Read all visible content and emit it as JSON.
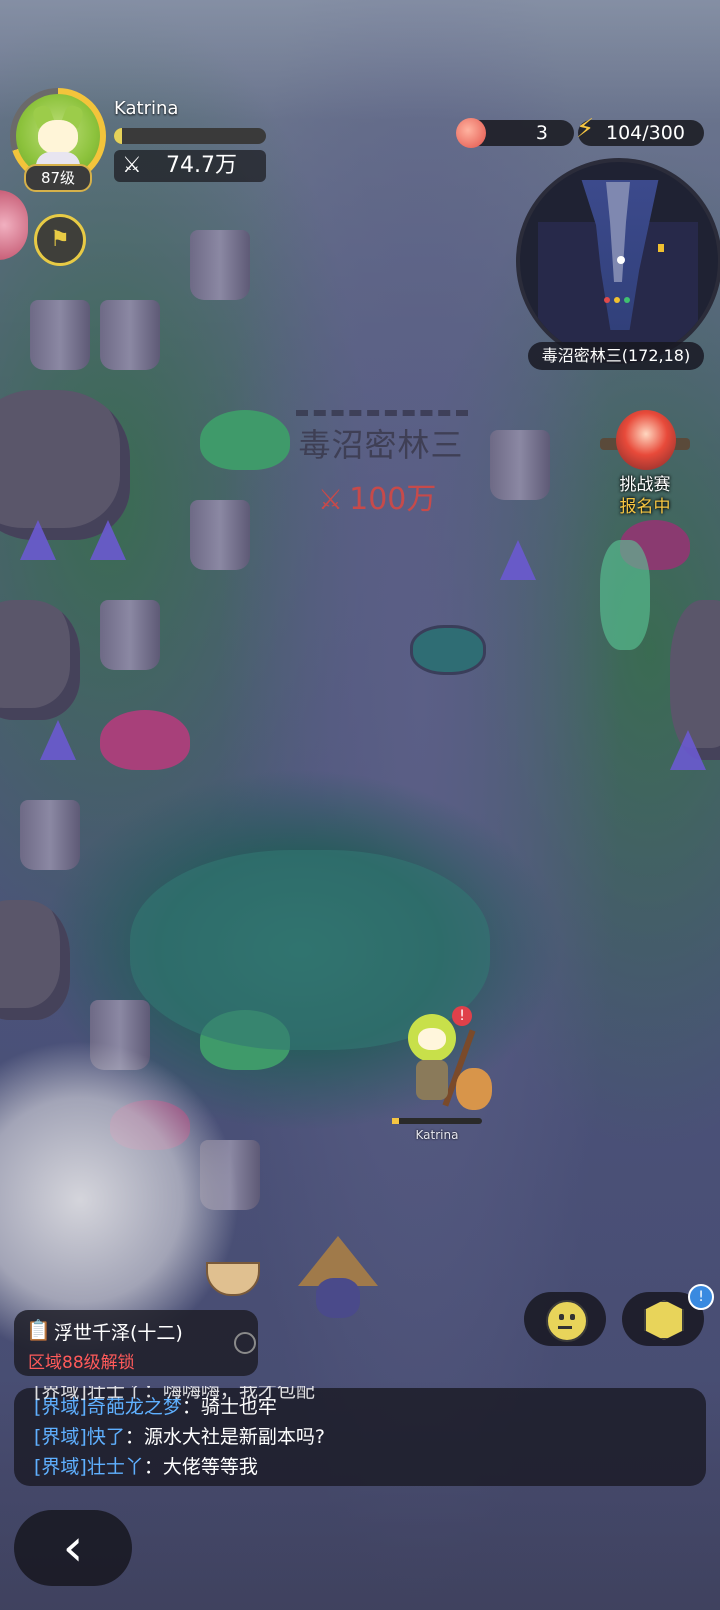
{
  "player": {
    "name": "Katrina",
    "level": "87级",
    "exp_fraction": 0.05,
    "power_icon": "crossed-swords-icon",
    "power": "74.7万"
  },
  "resources": {
    "peach_icon": "peach-icon",
    "peach_count": "3",
    "energy_icon": "lightning-icon",
    "energy": "104/300"
  },
  "minimap": {
    "label": "毒沼密林三(172,18)"
  },
  "zone_banner": {
    "name": "毒沼密林三",
    "required_power": "100万",
    "required_color": "#c74a4a"
  },
  "event": {
    "line1": "挑战赛",
    "line2": "报名中"
  },
  "world": {
    "player_tag": "Katrina",
    "player_alert": "!"
  },
  "zone_info": {
    "name": "浮世千泽(十二)",
    "unlock_text": "区域88级解锁"
  },
  "buttons": {
    "bag_badge": "!"
  },
  "chat": {
    "partial": "[界域]壮士丫：嗨嗨嗨，我才包配",
    "lines": [
      {
        "channel": "[界域]",
        "speaker": "奇葩龙之梦",
        "text": "：骑士也牢"
      },
      {
        "channel": "[界域]",
        "speaker": "快了",
        "text": "：源水大社是新副本吗?"
      },
      {
        "channel": "[界域]",
        "speaker": "壮士丫",
        "text": "：大佬等等我"
      }
    ]
  },
  "colors": {
    "accent_gold": "#f3c43b",
    "chat_channel": "#5fb0ff",
    "warning_red": "#ff5a5a"
  }
}
